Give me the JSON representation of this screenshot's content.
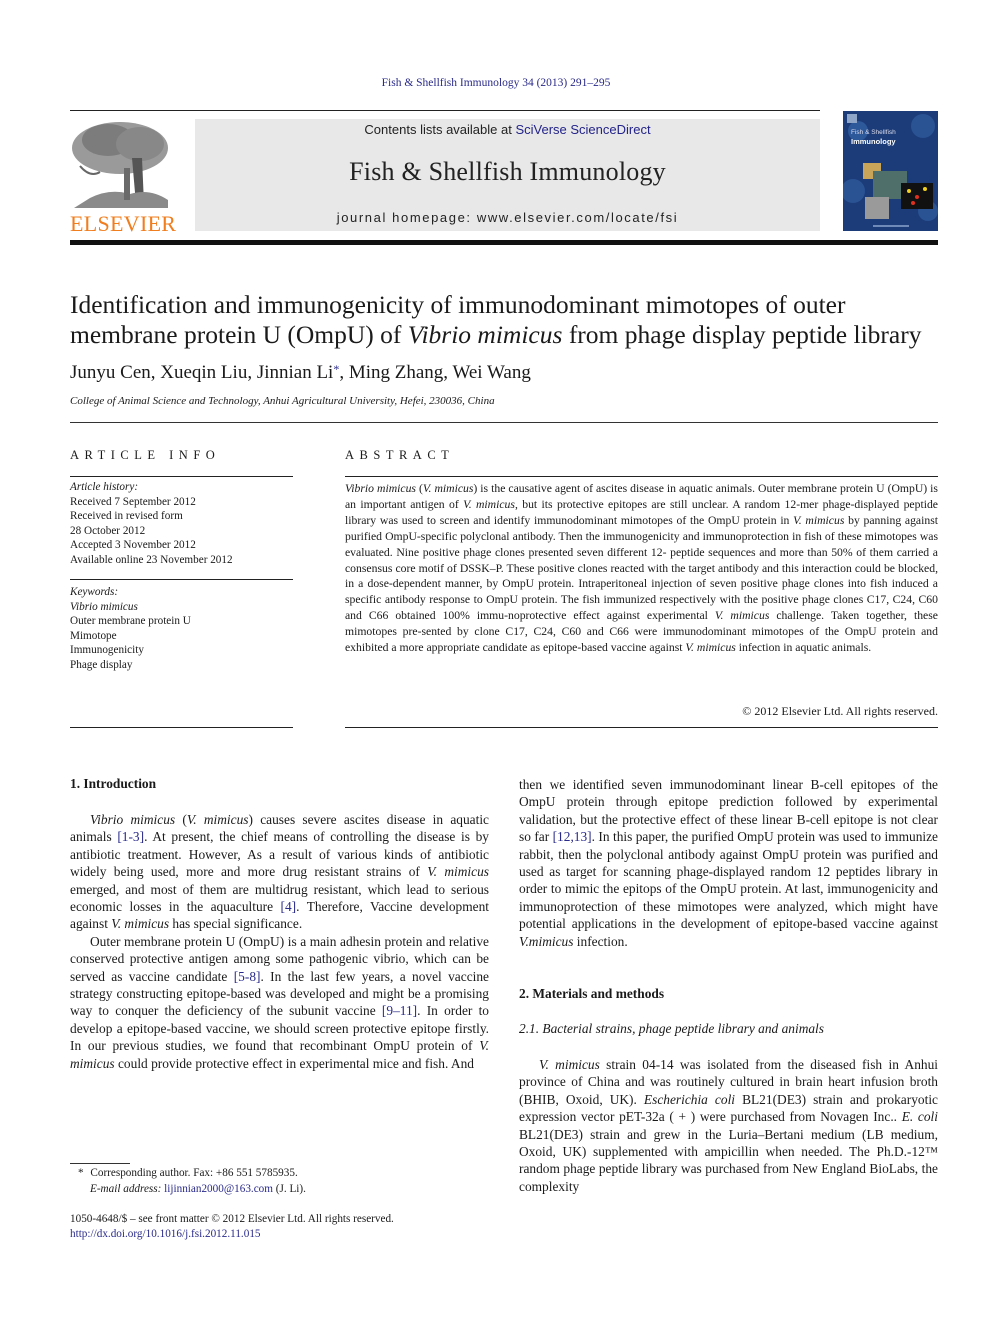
{
  "header": {
    "journal_ref": "Fish & Shellfish Immunology 34 (2013) 291–295",
    "contents_prefix": "Contents lists available at ",
    "contents_link": "SciVerse ScienceDirect",
    "journal_title": "Fish & Shellfish Immunology",
    "homepage": "journal homepage: www.elsevier.com/locate/fsi",
    "publisher_logo_text": "ELSEVIER",
    "cover_title_line1": "Fish & Shellfish",
    "cover_title_line2": "Immunology",
    "colors": {
      "elsevier_orange": "#f07d1e",
      "link_blue": "#2a2a8a",
      "masthead_gray": "#e8e8e8",
      "cover_blue": "#1b3c78"
    }
  },
  "article": {
    "title_part1": "Identification and immunogenicity of immunodominant mimotopes of outer membrane protein U (OmpU) of ",
    "title_italic": "Vibrio mimicus",
    "title_part2": " from phage display peptide library",
    "authors_before": "Junyu Cen, Xueqin Liu, Jinnian Li",
    "authors_star": "*",
    "authors_after": ", Ming Zhang, Wei Wang",
    "affiliation": "College of Animal Science and Technology, Anhui Agricultural University, Hefei, 230036, China"
  },
  "article_info": {
    "heading": "ARTICLE INFO",
    "history_label": "Article history:",
    "history": [
      "Received 7 September 2012",
      "Received in revised form",
      "28 October 2012",
      "Accepted 3 November 2012",
      "Available online 23 November 2012"
    ],
    "keywords_label": "Keywords:",
    "keywords_italic": "Vibrio mimicus",
    "keywords": [
      "Outer membrane protein U",
      "Mimotope",
      "Immunogenicity",
      "Phage display"
    ]
  },
  "abstract": {
    "heading": "ABSTRACT",
    "segments": [
      {
        "t": "Vibrio mimicus",
        "i": true
      },
      {
        "t": " (",
        "i": false
      },
      {
        "t": "V. mimicus",
        "i": true
      },
      {
        "t": ") is the causative agent of ascites disease in aquatic animals. Outer membrane protein U (OmpU) is an important antigen of ",
        "i": false
      },
      {
        "t": "V. mimicus",
        "i": true
      },
      {
        "t": ", but its protective epitopes are still unclear. A random 12-mer phage-displayed peptide library was used to screen and identify immunodominant mimotopes of the OmpU protein in ",
        "i": false
      },
      {
        "t": "V. mimicus",
        "i": true
      },
      {
        "t": " by panning against purified OmpU-specific polyclonal antibody. Then the immunogenicity and immunoprotection in fish of these mimotopes was evaluated. Nine positive phage clones presented seven different 12- peptide sequences and more than 50% of them carried a consensus core motif of DSSK–P. These positive clones reacted with the target antibody and this interaction could be blocked, in a dose-dependent manner, by OmpU protein. Intraperitoneal injection of seven positive phage clones into fish induced a specific antibody response to OmpU protein. The fish immunized respectively with the positive phage clones C17, C24, C60 and C66 obtained 100% immu-noprotective effect against experimental ",
        "i": false
      },
      {
        "t": "V. mimicus",
        "i": true
      },
      {
        "t": " challenge. Taken together, these mimotopes pre-sented by clone C17, C24, C60 and C66 were immunodominant mimotopes of the OmpU protein and exhibited a more appropriate candidate as epitope-based vaccine against ",
        "i": false
      },
      {
        "t": "V. mimicus",
        "i": true
      },
      {
        "t": " infection in aquatic animals.",
        "i": false
      }
    ],
    "copyright": "© 2012 Elsevier Ltd. All rights reserved."
  },
  "body": {
    "intro_title": "1.  Introduction",
    "intro_p1": [
      {
        "t": "Vibrio mimicus",
        "i": true
      },
      {
        "t": " (",
        "i": false
      },
      {
        "t": "V. mimicus",
        "i": true
      },
      {
        "t": ") causes severe ascites disease in aquatic animals ",
        "i": false
      },
      {
        "t": "[1-3]",
        "l": true
      },
      {
        "t": ". At present, the chief means of controlling the disease is by antibiotic treatment. However, As a result of various kinds of antibiotic widely being used, more and more drug resistant strains of ",
        "i": false
      },
      {
        "t": "V. mimicus",
        "i": true
      },
      {
        "t": " emerged, and most of them are multidrug resistant, which lead to serious economic losses in the aquaculture ",
        "i": false
      },
      {
        "t": "[4]",
        "l": true
      },
      {
        "t": ". Therefore, Vaccine development against ",
        "i": false
      },
      {
        "t": "V. mimicus",
        "i": true
      },
      {
        "t": " has special significance.",
        "i": false
      }
    ],
    "intro_p2": [
      {
        "t": "Outer membrane protein U (OmpU) is a main adhesin protein and relative conserved protective antigen among some pathogenic vibrio, which can be served as vaccine candidate ",
        "i": false
      },
      {
        "t": "[5-8]",
        "l": true
      },
      {
        "t": ". In the last few years, a novel vaccine strategy constructing epitope-based was developed and might be a promising way to conquer the deficiency of the subunit vaccine ",
        "i": false
      },
      {
        "t": "[9–11]",
        "l": true
      },
      {
        "t": ". In order to develop a epitope-based vaccine, we should screen protective epitope firstly. In our previous studies, we found that recombinant OmpU protein of ",
        "i": false
      },
      {
        "t": "V. mimicus",
        "i": true
      },
      {
        "t": " could provide protective effect in experimental mice and fish. And",
        "i": false
      }
    ],
    "intro_p2_cont": [
      {
        "t": "then we identified seven immunodominant linear B-cell epitopes of the OmpU protein through epitope prediction followed by experimental validation, but the protective effect of these linear B-cell epitope is not clear so far ",
        "i": false
      },
      {
        "t": "[12,13]",
        "l": true
      },
      {
        "t": ". In this paper, the purified OmpU protein was used to immunize rabbit, then the polyclonal antibody against OmpU protein was purified and used as target for scanning phage-displayed random 12 peptides library in order to mimic the epitops of the OmpU protein. At last, immunogenicity and immunoprotection of these mimotopes were analyzed, which might have potential applications in the development of epitope-based vaccine against ",
        "i": false
      },
      {
        "t": "V.mimicus",
        "i": true
      },
      {
        "t": " infection.",
        "i": false
      }
    ],
    "methods_title": "2.  Materials and methods",
    "subsection_title": "2.1.  Bacterial strains, phage peptide library and animals",
    "methods_p1": [
      {
        "t": "V. mimicus",
        "i": true
      },
      {
        "t": " strain 04-14 was isolated from the diseased fish in Anhui province of China and was routinely cultured in brain heart infusion broth (BHIB, Oxoid, UK). ",
        "i": false
      },
      {
        "t": "Escherichia coli",
        "i": true
      },
      {
        "t": " BL21(DE3) strain and prokaryotic expression vector pET-32a ( + ) were purchased from Novagen Inc.. ",
        "i": false
      },
      {
        "t": "E. coli",
        "i": true
      },
      {
        "t": " BL21(DE3) strain and grew in the Luria–Bertani medium (LB medium, Oxoid, UK) supplemented with ampicillin when needed. The Ph.D.-12™ random phage peptide library was purchased from New England BioLabs, the complexity",
        "i": false
      }
    ]
  },
  "footnote": {
    "star": "*",
    "corresponding": "Corresponding author. Fax: +86 551 5785935.",
    "email_label": "E-mail address: ",
    "email": "lijinnian2000@163.com",
    "email_suffix": " (J. Li).",
    "front_matter": "1050-4648/$ – see front matter © 2012 Elsevier Ltd. All rights reserved.",
    "doi": "http://dx.doi.org/10.1016/j.fsi.2012.11.015"
  }
}
